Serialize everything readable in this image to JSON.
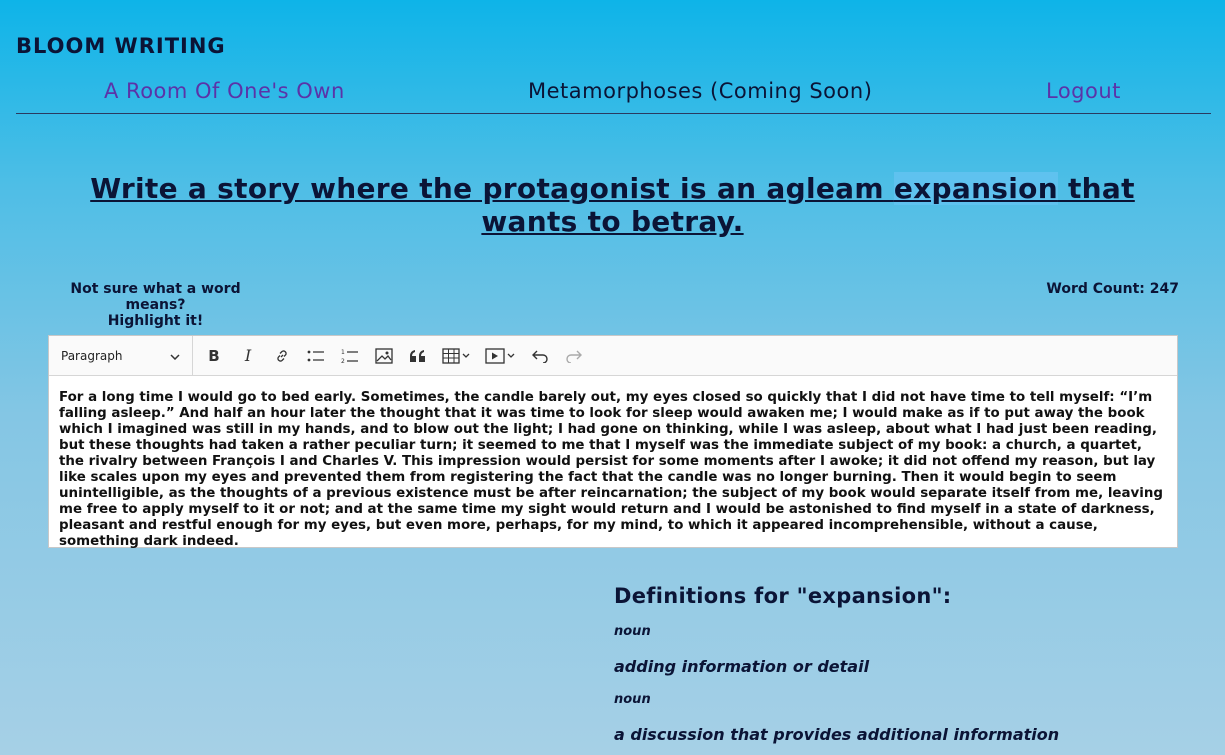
{
  "brand": "BLOOM WRITING",
  "nav": {
    "link1": "A Room Of One's Own",
    "link2": "Metamorphoses (Coming Soon)",
    "logout": "Logout"
  },
  "prompt": {
    "before": "Write a story where the protagonist is an agleam ",
    "highlight": "expansion",
    "after": " that wants to betray."
  },
  "hint": {
    "line1": "Not sure what a word means?",
    "line2": "Highlight it!"
  },
  "word_count": "Word Count: 247",
  "editor": {
    "block_style": "Paragraph",
    "toolbar_icons": [
      "bold-icon",
      "italic-icon",
      "link-icon",
      "bulleted-list-icon",
      "numbered-list-icon",
      "image-icon",
      "quote-icon",
      "table-icon",
      "media-icon",
      "undo-icon",
      "redo-icon"
    ],
    "text": "For a long time I would go to bed early. Sometimes, the candle barely out, my eyes closed so quickly that I did not have time to tell myself: “I’m falling asleep.” And half an hour later the thought that it was time to look for sleep would awaken me; I would make as if to put away the book which I imagined was still in my hands, and to blow out the light; I had gone on thinking, while I was asleep, about what I had just been reading, but these thoughts had taken a rather peculiar turn; it seemed to me that I myself was the immediate subject of my book: a church, a quartet, the rivalry between François I and Charles V. This impression would persist for some moments after I awoke; it did not offend my reason, but lay like scales upon my eyes and prevented them from registering the fact that the candle was no longer burning. Then it would begin to seem unintelligible, as the thoughts of a previous existence must be after reincarnation; the subject of my book would separate itself from me, leaving me free to apply myself to it or not; and at the same time my sight would return and I would be astonished to find myself in a state of darkness, pleasant and restful enough for my eyes, but even more, perhaps, for my mind, to which it appeared incomprehensible, without a cause, something dark indeed."
  },
  "definitions": {
    "title": "Definitions for \"expansion\":",
    "entries": [
      {
        "pos": "noun",
        "meaning": "adding information or detail"
      },
      {
        "pos": "noun",
        "meaning": "a discussion that provides additional information"
      }
    ]
  },
  "colors": {
    "link_purple": "#5b33a8",
    "text_navy": "#0b1436",
    "highlight": "#5fc2ef"
  }
}
